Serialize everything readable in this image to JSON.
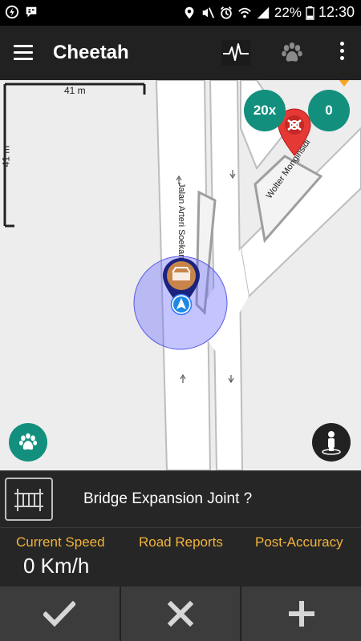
{
  "status_bar": {
    "battery_percent": "22%",
    "time": "12:30",
    "icons": [
      "lightning-icon",
      "bbm-icon",
      "location-icon",
      "mute-icon",
      "alarm-icon",
      "wifi-icon",
      "signal-icon",
      "battery-icon"
    ]
  },
  "toolbar": {
    "title": "Cheetah",
    "menu_icon": "hamburger-menu-icon",
    "actions": [
      "heartbeat-icon",
      "paw-icon",
      "overflow-menu-icon"
    ]
  },
  "map": {
    "scale_horizontal": "41 m",
    "scale_vertical": "41 m",
    "street_1": "Jalan Arteri Soekarno",
    "street_2": "Wolter Monginsidi",
    "zoom_badge": "20x",
    "count_badge": "0",
    "fab_left_icon": "paw-icon",
    "fab_right_icon": "street-view-person-icon"
  },
  "report": {
    "icon": "bridge-icon",
    "title": "Bridge Expansion Joint ?"
  },
  "stats": {
    "current_speed_label": "Current Speed",
    "road_reports_label": "Road Reports",
    "post_accuracy_label": "Post-Accuracy",
    "speed_value": "0 Km/h"
  },
  "actions": {
    "confirm_icon": "check-icon",
    "cancel_icon": "close-icon",
    "add_icon": "plus-icon"
  },
  "colors": {
    "toolbar_bg": "#212121",
    "accent_teal": "#12907d",
    "label_orange": "#f2b43b",
    "marker_red": "#e53935",
    "accuracy_blue": "#6b6bff"
  }
}
